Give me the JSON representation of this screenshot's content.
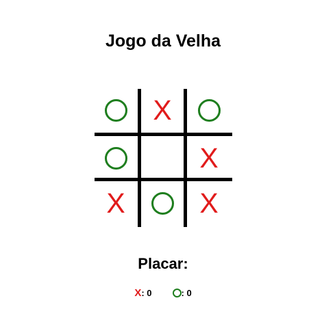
{
  "title": "Jogo da Velha",
  "board": {
    "cells": [
      "O",
      "X",
      "O",
      "O",
      "",
      "X",
      "X",
      "O",
      "X"
    ]
  },
  "score": {
    "heading": "Placar:",
    "x_label": "X",
    "x_value": ": 0",
    "o_value": ": 0"
  },
  "colors": {
    "x": "#e11b1b",
    "o": "#1e7e1e",
    "grid": "#000000"
  }
}
